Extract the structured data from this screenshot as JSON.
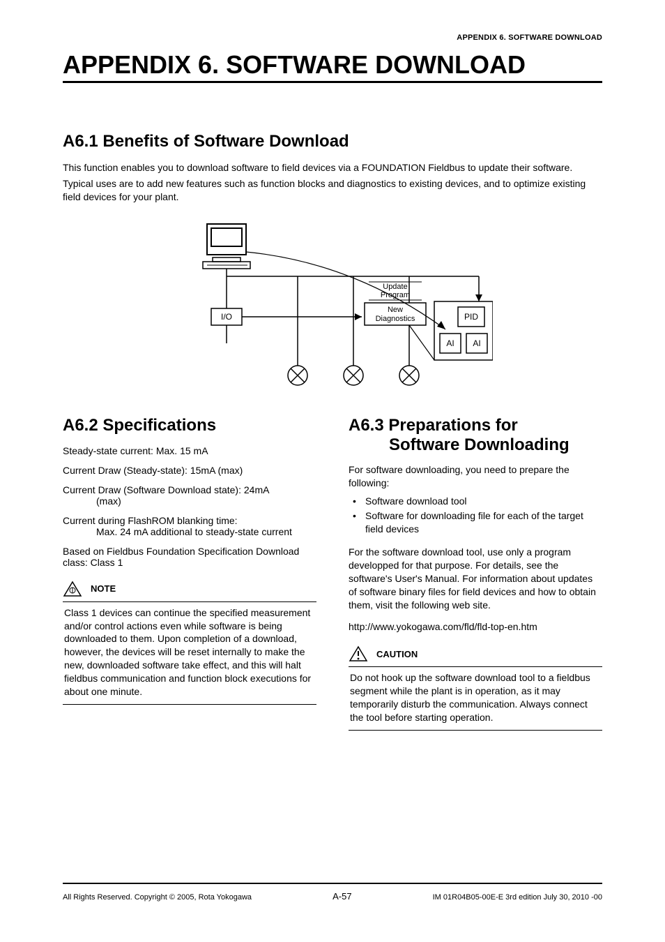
{
  "header": {
    "label": "APPENDIX 6. SOFTWARE DOWNLOAD"
  },
  "title": "APPENDIX 6. SOFTWARE DOWNLOAD",
  "section1": {
    "heading": "A6.1 Benefits of Software Download",
    "p1": "This function enables you to download software to field devices via a FOUNDATION Fieldbus to update their software.",
    "p2": "Typical uses are to add new features such as function blocks and diagnostics to existing devices, and to optimize existing field devices for your plant."
  },
  "diagram": {
    "io": "I/O",
    "update_program_l1": "Update",
    "update_program_l2": "Program",
    "new_diag_l1": "New",
    "new_diag_l2": "Diagnostics",
    "pid": "PID",
    "ai": "AI"
  },
  "section2": {
    "heading": "A6.2 Specifications",
    "l1": "Steady-state current: Max. 15 mA",
    "l2": "Current Draw (Steady-state): 15mA (max)",
    "l3a": "Current Draw (Software Download state): 24mA",
    "l3b": "(max)",
    "l4a": "Current during FlashROM blanking time:",
    "l4b": "Max. 24 mA additional to steady-state current",
    "l5": "Based on Fieldbus Foundation Specification Download class: Class 1",
    "note_label": "NOTE",
    "note_text": "Class 1 devices can continue the specified measurement and/or control actions even while software is being downloaded to them.  Upon completion of a download, however, the devices will be reset internally to make the new, downloaded software take effect, and this will halt fieldbus communication and function block executions for about one minute."
  },
  "section3": {
    "heading_l1": "A6.3 Preparations for",
    "heading_l2": "Software Downloading",
    "p1": "For software downloading, you need to prepare the following:",
    "b1": "Software download tool",
    "b2": "Software for downloading file for each of the target field devices",
    "p2": "For the software download tool, use only a program developped for that purpose.  For details, see the software's User's Manual.  For information about updates of software binary files for field devices and how to obtain them, visit the following web site.",
    "url": "http://www.yokogawa.com/fld/fld-top-en.htm",
    "caution_label": "CAUTION",
    "caution_text": "Do not hook up the software download tool to a fieldbus segment while the plant is in operation, as it may temporarily disturb the communication.  Always connect the tool before starting operation."
  },
  "footer": {
    "left": "All Rights Reserved. Copyright © 2005, Rota Yokogawa",
    "center": "A-57",
    "right": "IM 01R04B05-00E-E   3rd edition July 30, 2010 -00"
  }
}
